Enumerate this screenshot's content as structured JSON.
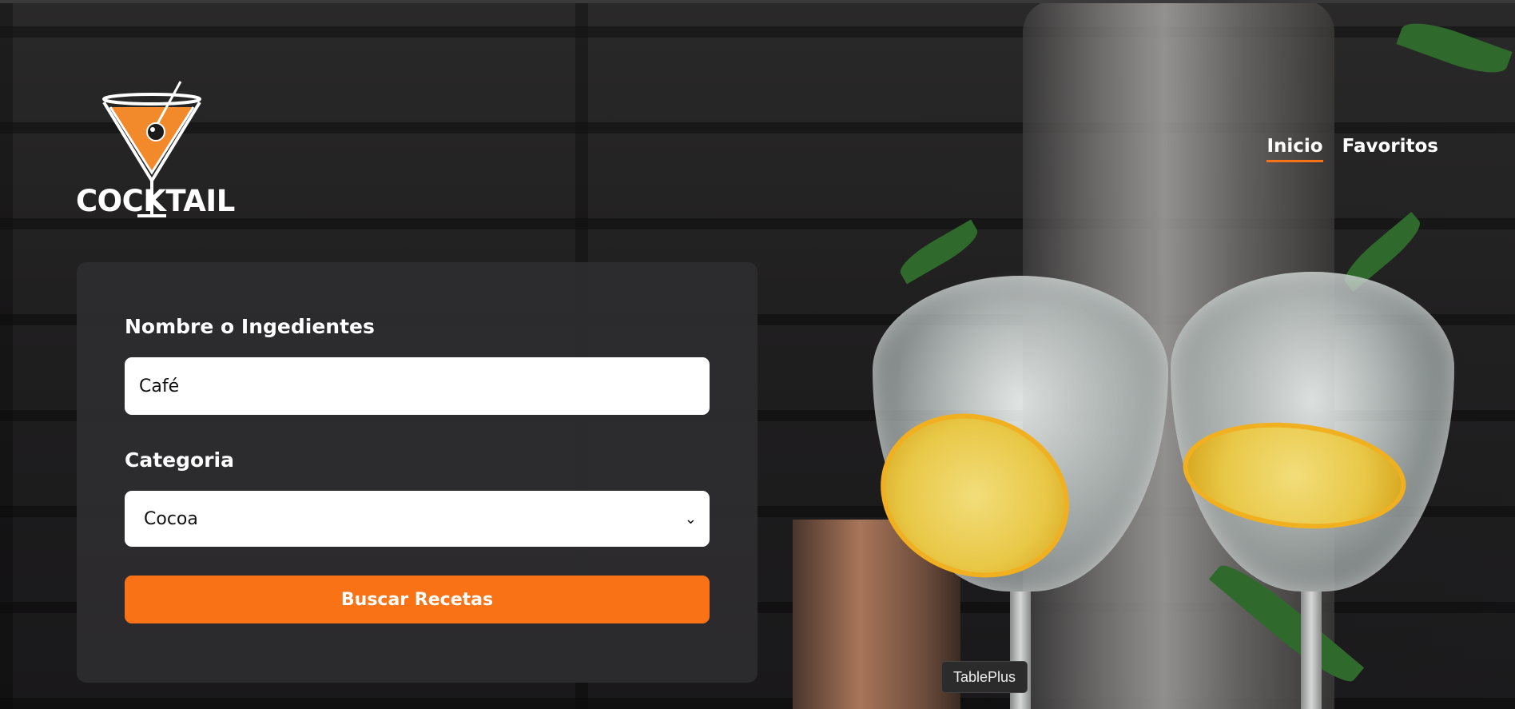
{
  "brand": {
    "name": "COCKTAIL",
    "accent": "#f97316"
  },
  "nav": {
    "items": [
      {
        "label": "Inicio",
        "active": true
      },
      {
        "label": "Favoritos",
        "active": false
      }
    ]
  },
  "form": {
    "name_label": "Nombre o Ingedientes",
    "name_value": "Café",
    "category_label": "Categoria",
    "category_value": "Cocoa",
    "submit_label": "Buscar Recetas"
  },
  "tooltip": {
    "text": "TablePlus"
  },
  "icons": {
    "logo": "martini-glass-icon",
    "dropdown": "chevron-down-icon"
  }
}
